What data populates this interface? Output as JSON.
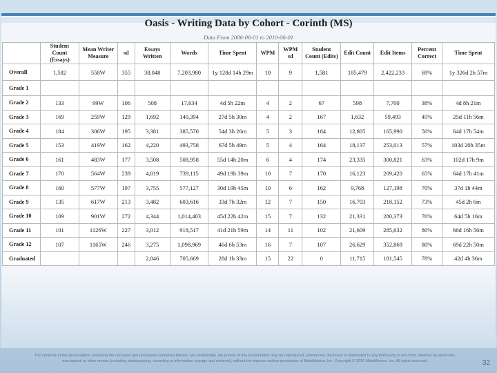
{
  "slide": {
    "title": "Oasis - Writing Data by Cohort - Corinth (MS)",
    "subtitle": "Data From 2006-06-01 to 2010-06-01",
    "footer": "The contents of this presentation, including the concepts and processes contained therein, are confidential. No portion of this presentation may be reproduced, referenced, disclosed or distributed to any third party in any form, whether by electronic, mechanical or other means (including photocopying, recording or information storage and retrieval), without the express written permission of MetaMetrics, Inc. Copyright © 2010 MetaMetrics, Inc. All rights reserved.",
    "page_number": "32"
  },
  "table": {
    "headers": [
      "",
      "Student Count (Essays)",
      "Mean Writer Measure",
      "sd",
      "Essays Written",
      "Words",
      "Time Spent",
      "WPM",
      "WPM sd",
      "Student Count (Edits)",
      "Edit Count",
      "Edit Items",
      "Percent Correct",
      "Time Spent"
    ],
    "rows": [
      [
        "Overall",
        "1,582",
        "558W",
        "355",
        "38,048",
        "7,203,980",
        "1y 128d 14h 29m",
        "10",
        "9",
        "1,581",
        "185,479",
        "2,422,233",
        "69%",
        "1y 326d 2h 57m"
      ],
      [
        "Grade 1",
        "",
        "",
        "",
        "",
        "",
        "",
        "",
        "",
        "",
        "",
        "",
        "",
        ""
      ],
      [
        "Grade 2",
        "133",
        "99W",
        "106",
        "508",
        "17,634",
        "4d 5h 22m",
        "4",
        "2",
        "67",
        "598",
        "7,700",
        "38%",
        "4d 8h 21m"
      ],
      [
        "Grade 3",
        "169",
        "259W",
        "129",
        "1,692",
        "140,394",
        "27d 5h 30m",
        "4",
        "2",
        "167",
        "1,632",
        "59,493",
        "45%",
        "25d 11h 56m"
      ],
      [
        "Grade 4",
        "184",
        "306W",
        "195",
        "3,381",
        "385,570",
        "54d 3h 26m",
        "5",
        "3",
        "184",
        "12,805",
        "165,990",
        "50%",
        "64d 17h 54m"
      ],
      [
        "Grade 5",
        "153",
        "419W",
        "162",
        "4,220",
        "493,758",
        "67d 5h 49m",
        "5",
        "4",
        "164",
        "18,137",
        "253,013",
        "57%",
        "103d 20h 35m"
      ],
      [
        "Grade 6",
        "161",
        "483W",
        "177",
        "3,508",
        "508,958",
        "55d 14h 20m",
        "6",
        "4",
        "174",
        "23,335",
        "300,821",
        "63%",
        "102d 17h 9m"
      ],
      [
        "Grade 7",
        "170",
        "564W",
        "239",
        "4,819",
        "739,115",
        "49d 19h 39m",
        "10",
        "7",
        "170",
        "16,123",
        "209,420",
        "65%",
        "64d 17h 41m"
      ],
      [
        "Grade 8",
        "160",
        "577W",
        "197",
        "3,755",
        "577,127",
        "30d 19h 45m",
        "10",
        "6",
        "162",
        "9,768",
        "127,198",
        "70%",
        "37d 1h 44m"
      ],
      [
        "Grade 9",
        "135",
        "617W",
        "213",
        "3,482",
        "603,616",
        "33d 7h 32m",
        "12",
        "7",
        "150",
        "16,703",
        "218,152",
        "73%",
        "45d 2h 6m"
      ],
      [
        "Grade 10",
        "109",
        "901W",
        "272",
        "4,344",
        "1,014,403",
        "45d 22h 42m",
        "15",
        "7",
        "132",
        "21,331",
        "280,373",
        "76%",
        "64d 5h 16m"
      ],
      [
        "Grade 11",
        "101",
        "1126W",
        "227",
        "3,012",
        "918,517",
        "41d 21h 59m",
        "14",
        "11",
        "102",
        "21,609",
        "285,632",
        "80%",
        "66d 16h 56m"
      ],
      [
        "Grade 12",
        "107",
        "1165W",
        "246",
        "3,275",
        "1,098,969",
        "46d 6h 53m",
        "16",
        "7",
        "107",
        "26,629",
        "352,869",
        "80%",
        "69d 22h 50m"
      ],
      [
        "Graduated",
        "",
        "",
        "",
        "2,046",
        "705,669",
        "28d 1h 33m",
        "15",
        "22",
        "0",
        "11,715",
        "181,545",
        "78%",
        "42d 4h 36m"
      ]
    ]
  }
}
